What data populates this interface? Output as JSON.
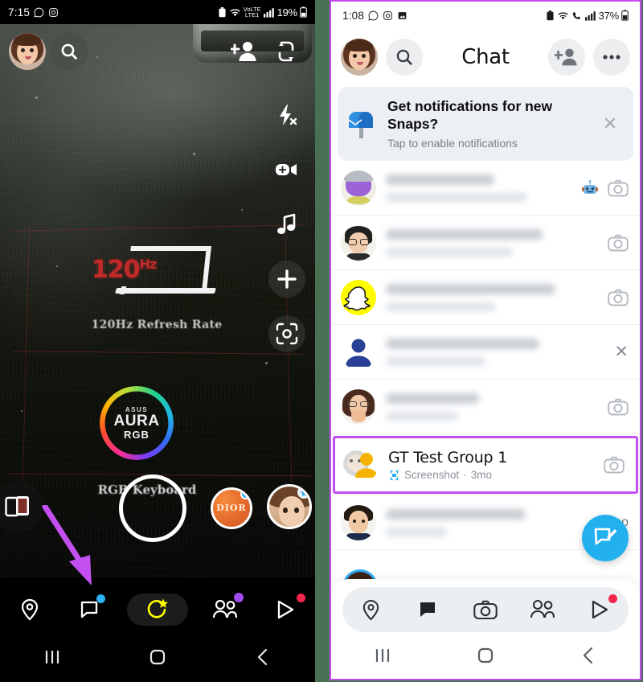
{
  "left_phone": {
    "status_bar": {
      "time": "7:15",
      "icons": [
        "whatsapp-icon",
        "instagram-icon"
      ],
      "right_icons": [
        "battery-saver-icon",
        "wifi-icon",
        "volte-lte-icon",
        "signal-icon"
      ],
      "battery": "19%"
    },
    "camera": {
      "overlay_headline": "120",
      "overlay_headline_unit": "Hz",
      "overlay_caption": "120Hz Refresh Rate",
      "logo_brand": "ASUS",
      "logo_main": "AURA",
      "logo_sub": "RGB",
      "keyboard_label": "RGB Keyboard"
    },
    "top_controls": [
      {
        "name": "profile-avatar",
        "label": "Profile"
      },
      {
        "name": "search-icon",
        "label": "Search"
      },
      {
        "name": "add-friend-icon",
        "label": "Add Friend"
      },
      {
        "name": "flip-camera-icon",
        "label": "Flip Camera"
      }
    ],
    "right_rail": [
      {
        "name": "flash-off-icon",
        "label": "Flash Off"
      },
      {
        "name": "night-mode-icon",
        "label": "Night Mode"
      },
      {
        "name": "music-icon",
        "label": "Sounds"
      },
      {
        "name": "add-icon",
        "label": "Add"
      },
      {
        "name": "scan-icon",
        "label": "Scan"
      }
    ],
    "carousel": {
      "memories_label": "Memories",
      "shutter_label": "Capture",
      "lens_one_label": "DIOR",
      "lens_two_label": "Character Lens"
    },
    "bottom_nav": [
      {
        "name": "map-icon",
        "label": "Map",
        "dot": null
      },
      {
        "name": "chat-icon",
        "label": "Chat",
        "dot": "#2ab3f5"
      },
      {
        "name": "camera-lens-icon",
        "label": "Camera",
        "dot": null,
        "active": true
      },
      {
        "name": "friends-icon",
        "label": "Friends",
        "dot": "#a04df0"
      },
      {
        "name": "spotlight-icon",
        "label": "Spotlight",
        "dot": "#f4254a"
      }
    ],
    "system_nav": [
      "recents-icon",
      "home-icon",
      "back-icon"
    ],
    "annotation": {
      "name": "pointer-arrow",
      "color": "#c44ff0",
      "target": "chat-icon"
    }
  },
  "right_phone": {
    "status_bar": {
      "time": "1:08",
      "icons": [
        "whatsapp-icon",
        "instagram-icon",
        "gallery-icon"
      ],
      "right_icons": [
        "battery-saver-icon",
        "wifi-icon",
        "volte-call-icon",
        "signal-icon"
      ],
      "battery": "37%"
    },
    "header": {
      "title": "Chat",
      "avatar_name": "profile-avatar",
      "search_label": "Search",
      "add_friend_label": "Add Friend",
      "more_label": "More options"
    },
    "notification_banner": {
      "icon": "mailbox-icon",
      "title": "Get notifications for new Snaps?",
      "subtitle": "Tap to enable notifications",
      "close_label": "Dismiss"
    },
    "chat_rows": [
      {
        "name": "chat-row-1",
        "redacted": true,
        "avatar": "bitmoji-purple-alien",
        "trailing": [
          "robot-emoji",
          "camera-icon"
        ]
      },
      {
        "name": "chat-row-2",
        "redacted": true,
        "avatar": "bitmoji-glasses-man",
        "trailing": [
          "camera-icon"
        ]
      },
      {
        "name": "chat-row-3",
        "redacted": true,
        "avatar": "snapchat-ghost",
        "trailing": [
          "camera-icon"
        ]
      },
      {
        "name": "chat-row-4",
        "redacted": true,
        "avatar": "default-person",
        "trailing": [
          "close-icon"
        ]
      },
      {
        "name": "chat-row-5",
        "redacted": true,
        "avatar": "bitmoji-woman-glasses",
        "trailing": [
          "camera-icon"
        ]
      },
      {
        "name": "chat-row-gt-test-group",
        "redacted": false,
        "highlighted": true,
        "avatar": "group-avatar",
        "title": "GT Test Group 1",
        "status_icon": "screenshot-icon",
        "status": "Screenshot",
        "separator": "·",
        "time": "3mo",
        "trailing": [
          "camera-icon"
        ]
      },
      {
        "name": "chat-row-7",
        "redacted": true,
        "avatar": "bitmoji-man-suit",
        "trailing_text": "no"
      }
    ],
    "fab": {
      "name": "new-chat-button",
      "icon": "compose-icon",
      "color": "#23b0ef"
    },
    "bottom_nav": [
      {
        "name": "map-icon",
        "label": "Map",
        "dot": null
      },
      {
        "name": "chat-icon",
        "label": "Chat",
        "dot": null,
        "active": true
      },
      {
        "name": "camera-icon",
        "label": "Camera",
        "dot": null
      },
      {
        "name": "friends-icon",
        "label": "Friends",
        "dot": null
      },
      {
        "name": "spotlight-icon",
        "label": "Spotlight",
        "dot": "#f4254a"
      }
    ],
    "system_nav": [
      "recents-icon",
      "home-icon",
      "back-icon"
    ]
  },
  "colors": {
    "page_background": "#4a7054",
    "highlight_purple": "#c44ff0",
    "snap_blue": "#23b0ef",
    "snap_yellow": "#fffc00",
    "spotlight_red": "#f4254a"
  }
}
